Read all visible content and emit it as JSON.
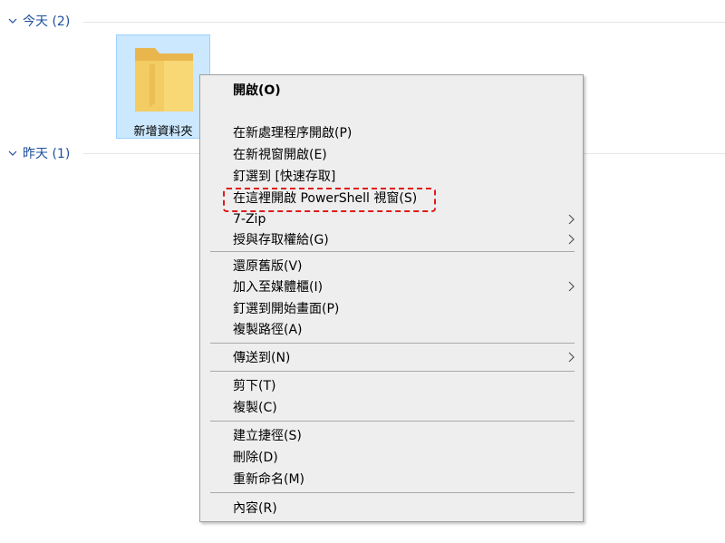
{
  "groups": [
    {
      "label": "今天 (2)"
    },
    {
      "label": "昨天 (1)"
    }
  ],
  "selected_item": {
    "name": "新增資料夾",
    "icon": "folder-icon"
  },
  "context_menu": {
    "items": [
      {
        "label": "開啟(O)",
        "bold": true
      },
      {
        "label": "在新處理程序開啟(P)"
      },
      {
        "label": "在新視窗開啟(E)"
      },
      {
        "label": "釘選到 [快速存取]"
      },
      {
        "label": "在這裡開啟 PowerShell 視窗(S)",
        "highlighted": true
      },
      {
        "label": "7-Zip",
        "submenu": true
      },
      {
        "label": "授與存取權給(G)",
        "submenu": true
      },
      {
        "label": "還原舊版(V)"
      },
      {
        "label": "加入至媒體櫃(I)",
        "submenu": true
      },
      {
        "label": "釘選到開始畫面(P)"
      },
      {
        "label": "複製路徑(A)"
      },
      {
        "label": "傳送到(N)",
        "submenu": true
      },
      {
        "label": "剪下(T)"
      },
      {
        "label": "複製(C)"
      },
      {
        "label": "建立捷徑(S)"
      },
      {
        "label": "刪除(D)"
      },
      {
        "label": "重新命名(M)"
      },
      {
        "label": "內容(R)"
      }
    ]
  },
  "colors": {
    "group_header": "#1f4e9a",
    "selection_bg": "#cce8ff",
    "highlight_border": "#e01b1b",
    "menu_bg": "#eeeeee"
  }
}
